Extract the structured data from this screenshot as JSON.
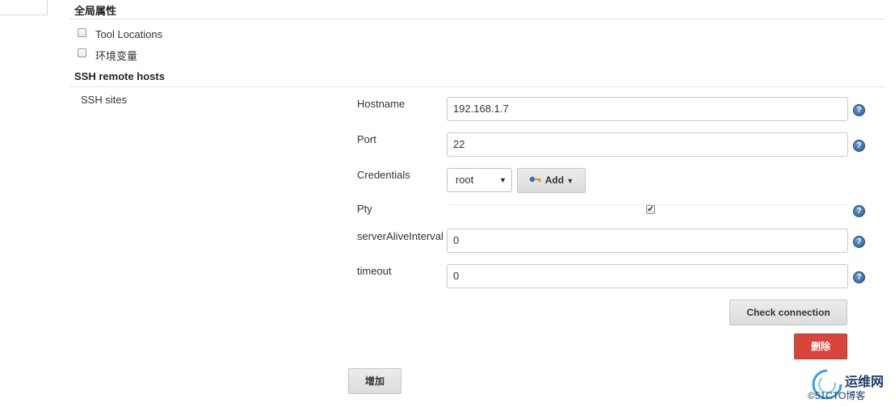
{
  "global": {
    "title": "全局属性",
    "tool_locations": "Tool Locations",
    "env_vars": "环境变量"
  },
  "ssh": {
    "title": "SSH remote hosts",
    "sites_label": "SSH sites",
    "hostname_label": "Hostname",
    "hostname_value": "192.168.1.7",
    "port_label": "Port",
    "port_value": "22",
    "credentials_label": "Credentials",
    "credentials_value": "root",
    "add_label": "Add",
    "pty_label": "Pty",
    "pty_checked": true,
    "alive_label": "serverAliveInterval",
    "alive_value": "0",
    "timeout_label": "timeout",
    "timeout_value": "0",
    "check_label": "Check connection",
    "delete_label": "删除",
    "add_site_label": "增加"
  },
  "help_glyph": "?",
  "watermark": {
    "text": "运维网",
    "sub": "©51CTO博客"
  },
  "colors": {
    "delete_button": "#d9453b",
    "help_icon": "#2e6399"
  }
}
